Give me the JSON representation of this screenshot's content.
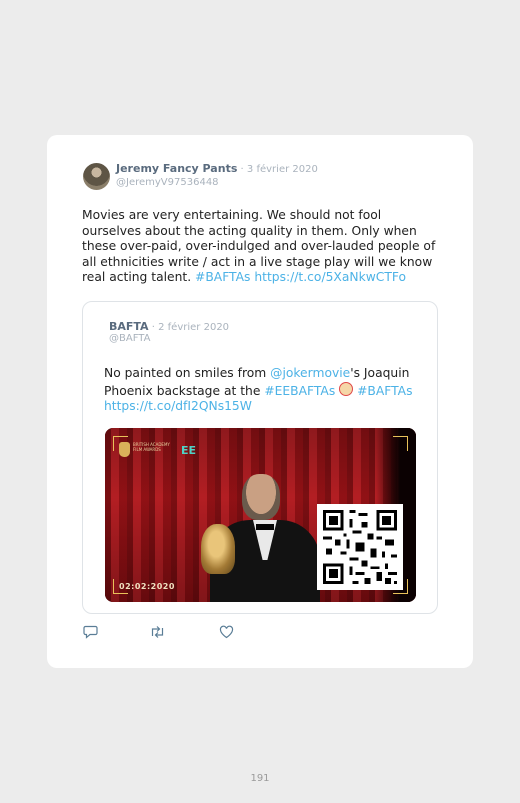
{
  "tweet": {
    "author_name": "Jeremy Fancy Pants",
    "separator": " · ",
    "date": "3 février 2020",
    "handle": "@JeremyV97536448",
    "text": "Movies are very entertaining. We should not fool ourselves about the acting quality in them. Only when these over-paid, over-indulged and over-lauded people of all ethnicities write / act in a live stage play will we know real acting talent.",
    "hashtag": "#BAFTAs",
    "link": "https://t.co/5XaNkwCTFo"
  },
  "quoted": {
    "author_name": "BAFTA",
    "separator": " · ",
    "date": "2 février 2020",
    "handle": "@BAFTA",
    "text_before": "No painted on smiles from ",
    "mention": "@jokermovie",
    "text_after": "'s Joaquin Phoenix backstage at the ",
    "hashtag1": "#EEBAFTAs",
    "hashtag2": "#BAFTAs",
    "link": "https://t.co/dfI2QNs15W",
    "media": {
      "logo_text": "BRITISH ACADEMY FILM AWARDS",
      "sponsor": "EE",
      "timestamp": "02:02:2020",
      "icon": "qr-code-icon"
    }
  },
  "actions": {
    "reply_icon": "reply-icon",
    "retweet_icon": "retweet-icon",
    "like_icon": "heart-icon"
  },
  "page_number": "191",
  "colors": {
    "link": "#4cb2e6",
    "name": "#5a6b7e",
    "meta": "#aab3bd"
  }
}
